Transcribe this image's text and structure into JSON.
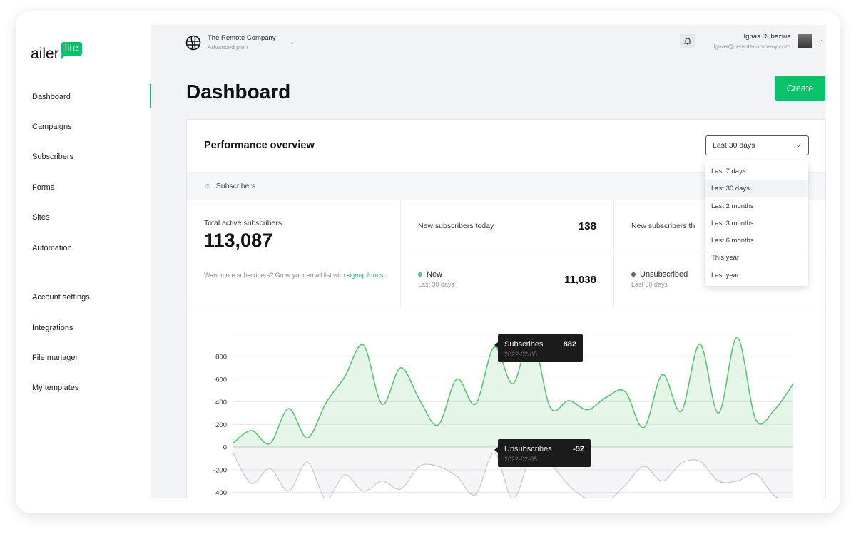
{
  "logo": {
    "text": "ailer",
    "badge": "lite"
  },
  "sidebar": {
    "items": [
      {
        "label": "Dashboard",
        "active": true
      },
      {
        "label": "Campaigns"
      },
      {
        "label": "Subscribers"
      },
      {
        "label": "Forms"
      },
      {
        "label": "Sites"
      },
      {
        "label": "Automation"
      }
    ],
    "secondary": [
      {
        "label": "Account settings"
      },
      {
        "label": "Integrations"
      },
      {
        "label": "File manager"
      },
      {
        "label": "My templates"
      }
    ]
  },
  "header": {
    "org_name": "The Remote Company",
    "org_plan": "Advanced plan",
    "user_name": "Ignas Rubezius",
    "user_email": "ignas@remotecompany.com"
  },
  "page": {
    "title": "Dashboard",
    "create_label": "Create"
  },
  "overview": {
    "title": "Performance overview",
    "range": "Last 30 days",
    "tab": "Subscribers",
    "options": [
      "Last 7 days",
      "Last 30 days",
      "Last 2 months",
      "Last 3 months",
      "Last 6 months",
      "This year",
      "Last year"
    ],
    "total_label": "Total active subscribers",
    "total_value": "113,087",
    "promo_text": "Want more subscribers? Grow your email list with ",
    "promo_link": "signup forms",
    "promo_end": ".",
    "today_label": "New subscribers today",
    "today_value": "138",
    "month_label": "New subscribers th",
    "new_label": "New",
    "new_sub": "Last 30 days",
    "new_value": "11,038",
    "unsub_label": "Unsubscribed",
    "unsub_sub": "Last 30 days"
  },
  "colors": {
    "accent": "#09c269",
    "subscribes": "#5cc476",
    "unsubscribes": "#cccccc"
  },
  "chart_data": {
    "type": "area",
    "ylim": [
      -450,
      1000
    ],
    "yticks": [
      -400,
      -200,
      0,
      200,
      400,
      600,
      800
    ],
    "grid": true,
    "series": [
      {
        "name": "Subscribes",
        "values": [
          30,
          145,
          30,
          340,
          80,
          390,
          620,
          900,
          380,
          700,
          420,
          195,
          600,
          380,
          882,
          560,
          980,
          350,
          410,
          330,
          440,
          490,
          170,
          640,
          315,
          910,
          300,
          970,
          240,
          330,
          560
        ]
      },
      {
        "name": "Unsubscribes",
        "values": [
          -40,
          -320,
          -190,
          -390,
          -135,
          -460,
          -245,
          -390,
          -300,
          -370,
          -170,
          -170,
          -260,
          -420,
          -52,
          -460,
          -80,
          -150,
          -340,
          -460,
          -480,
          -340,
          -170,
          -300,
          -145,
          -125,
          -300,
          -300,
          -240,
          -430,
          -490
        ]
      }
    ],
    "tooltips": [
      {
        "series": "Subscribes",
        "value": "882",
        "date": "2022-02-05"
      },
      {
        "series": "Unsubscribes",
        "value": "-52",
        "date": "2022-02-05"
      }
    ]
  }
}
